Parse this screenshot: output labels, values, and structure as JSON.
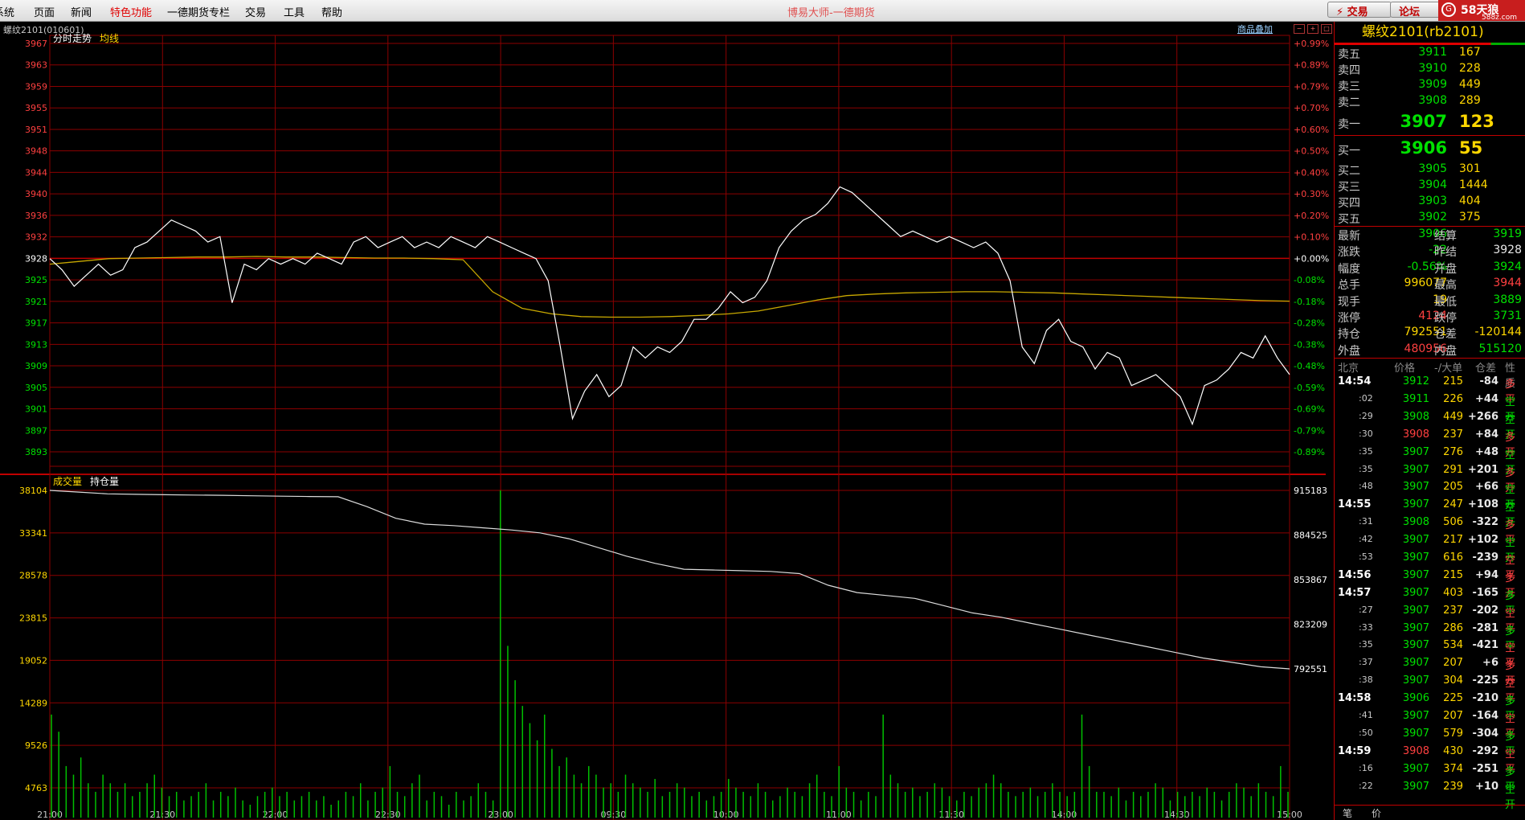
{
  "menu": {
    "items": [
      {
        "label": "系统",
        "hl": false
      },
      {
        "label": "页面",
        "hl": false
      },
      {
        "label": "新闻",
        "hl": false
      },
      {
        "label": "特色功能",
        "hl": true
      },
      {
        "label": "一德期货专栏",
        "hl": false
      },
      {
        "label": "交易",
        "hl": false
      },
      {
        "label": "工具",
        "hl": false
      },
      {
        "label": "帮助",
        "hl": false
      }
    ],
    "app_title": "博易大师-一德期货",
    "trade_button": "⚡ 交易",
    "forum_button": "论坛",
    "logo_text": "58天狼",
    "logo_sub": "588z.com"
  },
  "chart": {
    "symbol_label": "螺纹2101(010601)",
    "price_panel_title": "分时走势",
    "avg_label": "均线",
    "volume_title": "成交量",
    "oi_label": "持仓量",
    "overlay_link": "商品叠加"
  },
  "chart_data": {
    "type": "line",
    "prev_settle": 3928,
    "price_ticks": [
      "3967",
      "3963",
      "3959",
      "3955",
      "3951",
      "3948",
      "3944",
      "3940",
      "3936",
      "3932",
      "3928",
      "3925",
      "3921",
      "3917",
      "3913",
      "3909",
      "3905",
      "3901",
      "3897",
      "3893"
    ],
    "pct_ticks": [
      "+0.99%",
      "+0.89%",
      "+0.79%",
      "+0.70%",
      "+0.60%",
      "+0.50%",
      "+0.40%",
      "+0.30%",
      "+0.20%",
      "+0.10%",
      "+0.00%",
      "-0.08%",
      "-0.18%",
      "-0.28%",
      "-0.38%",
      "-0.48%",
      "-0.59%",
      "-0.69%",
      "-0.79%",
      "-0.89%"
    ],
    "volume_ticks": [
      "38104",
      "33341",
      "28578",
      "23815",
      "19052",
      "14289",
      "9526",
      "4763"
    ],
    "oi_ticks": [
      "915183",
      "884525",
      "853867",
      "823209",
      "792551"
    ],
    "time_ticks": [
      "21:00",
      "21:30",
      "22:00",
      "22:30",
      "23:00",
      "09:30",
      "10:00",
      "11:00",
      "11:30",
      "14:00",
      "14:30",
      "15:00"
    ],
    "price_series_name": "分时走势",
    "price": [
      3928,
      3926,
      3923,
      3925,
      3927,
      3925,
      3926,
      3930,
      3931,
      3933,
      3935,
      3934,
      3933,
      3931,
      3932,
      3920,
      3927,
      3926,
      3928,
      3927,
      3928,
      3927,
      3929,
      3928,
      3927,
      3931,
      3932,
      3930,
      3931,
      3932,
      3930,
      3931,
      3930,
      3932,
      3931,
      3930,
      3932,
      3931,
      3930,
      3929,
      3928,
      3924,
      3912,
      3899,
      3904,
      3907,
      3903,
      3905,
      3912,
      3910,
      3912,
      3911,
      3913,
      3917,
      3917,
      3919,
      3922,
      3920,
      3921,
      3924,
      3930,
      3933,
      3935,
      3936,
      3938,
      3941,
      3940,
      3938,
      3936,
      3934,
      3932,
      3933,
      3932,
      3931,
      3932,
      3931,
      3930,
      3931,
      3929,
      3924,
      3912,
      3909,
      3915,
      3917,
      3913,
      3912,
      3908,
      3911,
      3910,
      3905,
      3906,
      3907,
      3905,
      3903,
      3898,
      3905,
      3906,
      3908,
      3911,
      3910,
      3914,
      3910,
      3907
    ],
    "avg_series_name": "均线",
    "avg": [
      3927,
      3927.5,
      3928,
      3928.1,
      3928.2,
      3928.3,
      3928.3,
      3928.4,
      3928.3,
      3928.3,
      3928.2,
      3928.1,
      3928.1,
      3928.0,
      3927.8,
      3922,
      3919,
      3918,
      3917.5,
      3917.4,
      3917.4,
      3917.5,
      3917.7,
      3918,
      3918.5,
      3919.5,
      3920.5,
      3921.3,
      3921.6,
      3921.8,
      3921.9,
      3922,
      3922,
      3921.9,
      3921.8,
      3921.6,
      3921.4,
      3921.2,
      3921,
      3920.8,
      3920.6,
      3920.4,
      3920.3
    ],
    "oi_series_name": "持仓量",
    "oi": [
      915183,
      914000,
      912800,
      912500,
      912200,
      912000,
      911800,
      911500,
      911200,
      911000,
      910800,
      904000,
      896000,
      892000,
      891000,
      889500,
      888000,
      886000,
      882000,
      876000,
      870000,
      865000,
      861000,
      860500,
      860000,
      859500,
      858000,
      850000,
      845000,
      843000,
      841000,
      836000,
      831000,
      828000,
      824000,
      820000,
      816000,
      812000,
      808000,
      804000,
      800000,
      797000,
      794000,
      792551
    ],
    "volume_series_name": "成交量",
    "volume": [
      12000,
      10000,
      6000,
      5000,
      7000,
      4000,
      3000,
      5000,
      4000,
      3000,
      4000,
      2500,
      3000,
      4000,
      5000,
      3500,
      2500,
      3000,
      2000,
      2500,
      3000,
      4000,
      2000,
      3000,
      2500,
      3500,
      2000,
      1500,
      2500,
      3000,
      3500,
      2500,
      3000,
      2000,
      2500,
      3000,
      2000,
      2500,
      1500,
      2000,
      3000,
      2500,
      4000,
      2000,
      3000,
      3500,
      6000,
      3000,
      2500,
      4000,
      5000,
      2000,
      3000,
      2500,
      1500,
      3000,
      2000,
      2500,
      4000,
      3000,
      2000,
      38104,
      20000,
      16000,
      13000,
      11000,
      9000,
      12000,
      8000,
      6000,
      7000,
      5000,
      4000,
      6000,
      5000,
      3500,
      4000,
      3000,
      5000,
      4000,
      3500,
      3000,
      4500,
      2500,
      3000,
      4000,
      3500,
      2500,
      3000,
      2000,
      2500,
      3000,
      4500,
      3500,
      3000,
      2500,
      4000,
      3000,
      2000,
      2500,
      3500,
      3000,
      2500,
      4000,
      5000,
      3000,
      2500,
      6000,
      3500,
      3000,
      2000,
      3000,
      2500,
      12000,
      5000,
      4000,
      3000,
      3500,
      2500,
      3000,
      4000,
      3500,
      2500,
      2000,
      3000,
      2500,
      3500,
      4000,
      5000,
      4000,
      3000,
      2500,
      3000,
      3500,
      2500,
      3000,
      4000,
      3000,
      2500,
      3000,
      12000,
      6000,
      3000,
      3000,
      2500,
      3500,
      2000,
      3000,
      2500,
      3000,
      4000,
      3500,
      2000,
      3000,
      2500,
      3000,
      2500,
      3500,
      3000,
      2000,
      3000,
      4000,
      3500,
      2500,
      4000,
      3000,
      2500,
      6000,
      3000
    ]
  },
  "quote": {
    "header": "螺纹2101(rb2101)",
    "asks": [
      {
        "label": "卖五",
        "price": "3911",
        "vol": "167"
      },
      {
        "label": "卖四",
        "price": "3910",
        "vol": "228"
      },
      {
        "label": "卖三",
        "price": "3909",
        "vol": "449"
      },
      {
        "label": "卖二",
        "price": "3908",
        "vol": "289"
      },
      {
        "label": "卖一",
        "price": "3907",
        "vol": "123"
      }
    ],
    "bids": [
      {
        "label": "买一",
        "price": "3906",
        "vol": "55"
      },
      {
        "label": "买二",
        "price": "3905",
        "vol": "301"
      },
      {
        "label": "买三",
        "price": "3904",
        "vol": "1444"
      },
      {
        "label": "买四",
        "price": "3903",
        "vol": "404"
      },
      {
        "label": "买五",
        "price": "3902",
        "vol": "375"
      }
    ],
    "stats": [
      {
        "l1": "最新",
        "v1": "3906",
        "c1": "green",
        "l2": "结算",
        "v2": "3919",
        "c2": "green"
      },
      {
        "l1": "涨跌",
        "v1": "-22",
        "c1": "green",
        "l2": "昨结",
        "v2": "3928",
        "c2": "white"
      },
      {
        "l1": "幅度",
        "v1": "-0.56%",
        "c1": "green",
        "l2": "开盘",
        "v2": "3924",
        "c2": "green"
      },
      {
        "l1": "总手",
        "v1": "996077",
        "c1": "yellow",
        "l2": "最高",
        "v2": "3944",
        "c2": "red"
      },
      {
        "l1": "现手",
        "v1": "19",
        "c1": "yellow",
        "l2": "最低",
        "v2": "3889",
        "c2": "green"
      },
      {
        "l1": "涨停",
        "v1": "4124",
        "c1": "red",
        "l2": "跌停",
        "v2": "3731",
        "c2": "green"
      },
      {
        "l1": "持仓",
        "v1": "792551",
        "c1": "yellow",
        "l2": "仓差",
        "v2": "-120144",
        "c2": "yellow"
      },
      {
        "l1": "外盘",
        "v1": "480956",
        "c1": "red",
        "l2": "内盘",
        "v2": "515120",
        "c2": "green"
      }
    ],
    "tick_header": {
      "time": "北京",
      "price": "价格",
      "vol": "-/大单",
      "oi": "仓差",
      "nature": "性质"
    },
    "ticks": [
      {
        "t": "14:54",
        "big": true,
        "p": "3912",
        "pc": "green",
        "v": "215",
        "o": "-84",
        "n": "多平",
        "nc": "red"
      },
      {
        "t": ":02",
        "big": false,
        "p": "3911",
        "pc": "green",
        "v": "226",
        "o": "+44",
        "n": "空开",
        "nc": "green"
      },
      {
        "t": ":29",
        "big": false,
        "p": "3908",
        "pc": "green",
        "v": "449",
        "o": "+266",
        "n": "空开",
        "nc": "green"
      },
      {
        "t": ":30",
        "big": false,
        "p": "3908",
        "pc": "red",
        "v": "237",
        "o": "+84",
        "n": "多开",
        "nc": "red"
      },
      {
        "t": ":35",
        "big": false,
        "p": "3907",
        "pc": "green",
        "v": "276",
        "o": "+48",
        "n": "空开",
        "nc": "green"
      },
      {
        "t": ":35",
        "big": false,
        "p": "3907",
        "pc": "green",
        "v": "291",
        "o": "+201",
        "n": "多开",
        "nc": "red"
      },
      {
        "t": ":48",
        "big": false,
        "p": "3907",
        "pc": "green",
        "v": "205",
        "o": "+66",
        "n": "空开",
        "nc": "green"
      },
      {
        "t": "14:55",
        "big": true,
        "p": "3907",
        "pc": "green",
        "v": "247",
        "o": "+108",
        "n": "空开",
        "nc": "green"
      },
      {
        "t": ":31",
        "big": false,
        "p": "3908",
        "pc": "green",
        "v": "506",
        "o": "-322",
        "n": "多平",
        "nc": "red"
      },
      {
        "t": ":42",
        "big": false,
        "p": "3907",
        "pc": "green",
        "v": "217",
        "o": "+102",
        "n": "空开",
        "nc": "green"
      },
      {
        "t": ":53",
        "big": false,
        "p": "3907",
        "pc": "green",
        "v": "616",
        "o": "-239",
        "n": "空平",
        "nc": "red"
      },
      {
        "t": "14:56",
        "big": true,
        "p": "3907",
        "pc": "green",
        "v": "215",
        "o": "+94",
        "n": "多开",
        "nc": "red"
      },
      {
        "t": "14:57",
        "big": true,
        "p": "3907",
        "pc": "green",
        "v": "403",
        "o": "-165",
        "n": "多平",
        "nc": "green"
      },
      {
        "t": ":27",
        "big": false,
        "p": "3907",
        "pc": "green",
        "v": "237",
        "o": "-202",
        "n": "空平",
        "nc": "red"
      },
      {
        "t": ":33",
        "big": false,
        "p": "3907",
        "pc": "green",
        "v": "286",
        "o": "-281",
        "n": "多平",
        "nc": "green"
      },
      {
        "t": ":35",
        "big": false,
        "p": "3907",
        "pc": "green",
        "v": "534",
        "o": "-421",
        "n": "空平",
        "nc": "red"
      },
      {
        "t": ":37",
        "big": false,
        "p": "3907",
        "pc": "green",
        "v": "207",
        "o": "+6",
        "n": "多开",
        "nc": "red"
      },
      {
        "t": ":38",
        "big": false,
        "p": "3907",
        "pc": "green",
        "v": "304",
        "o": "-225",
        "n": "空平",
        "nc": "red"
      },
      {
        "t": "14:58",
        "big": true,
        "p": "3906",
        "pc": "green",
        "v": "225",
        "o": "-210",
        "n": "多平",
        "nc": "green"
      },
      {
        "t": ":41",
        "big": false,
        "p": "3907",
        "pc": "green",
        "v": "207",
        "o": "-164",
        "n": "空平",
        "nc": "red"
      },
      {
        "t": ":50",
        "big": false,
        "p": "3907",
        "pc": "green",
        "v": "579",
        "o": "-304",
        "n": "多平",
        "nc": "green"
      },
      {
        "t": "14:59",
        "big": true,
        "p": "3908",
        "pc": "red",
        "v": "430",
        "o": "-292",
        "n": "空平",
        "nc": "red"
      },
      {
        "t": ":16",
        "big": false,
        "p": "3907",
        "pc": "green",
        "v": "374",
        "o": "-251",
        "n": "多平",
        "nc": "green"
      },
      {
        "t": ":22",
        "big": false,
        "p": "3907",
        "pc": "green",
        "v": "239",
        "o": "+10",
        "n": "空开",
        "nc": "green"
      }
    ],
    "bottom_tabs": [
      "笔",
      "价"
    ]
  },
  "colors": {
    "grid": "#8b0000",
    "price_line": "#ffffff",
    "avg_line": "#c8a800",
    "oi_line": "#dcdcdc",
    "vol_bar": "#00c000",
    "up": "#ff4040",
    "down": "#00e000"
  }
}
